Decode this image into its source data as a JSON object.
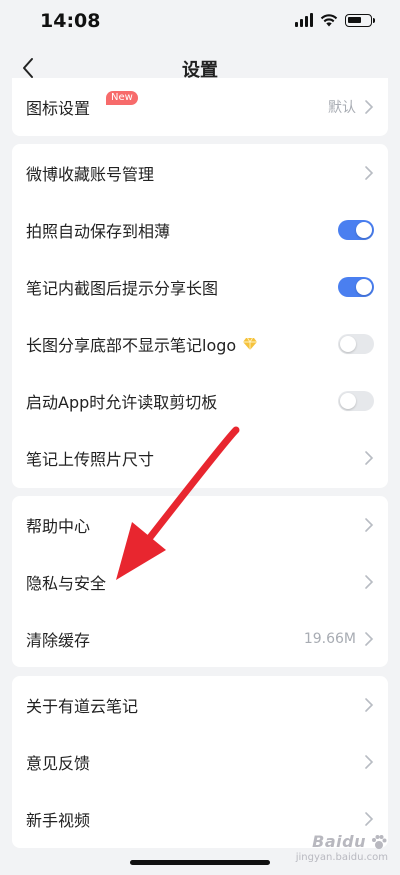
{
  "status_bar": {
    "time": "14:08",
    "icons": [
      "signal-icon",
      "wifi-icon",
      "battery-icon"
    ]
  },
  "nav": {
    "title": "设置",
    "back_icon": "chevron-left-icon"
  },
  "card_top": {
    "items": [
      {
        "label": "图标设置",
        "badge": "New",
        "value": "默认"
      }
    ]
  },
  "card_prefs": {
    "items": [
      {
        "label": "微博收藏账号管理"
      },
      {
        "label": "拍照自动保存到相薄",
        "toggle": true
      },
      {
        "label": "笔记内截图后提示分享长图",
        "toggle": true
      },
      {
        "label": "长图分享底部不显示笔记logo",
        "vip_icon": "diamond-icon",
        "toggle": false
      },
      {
        "label": "启动App时允许读取剪切板",
        "toggle": false
      },
      {
        "label": "笔记上传照片尺寸"
      }
    ]
  },
  "card_help": {
    "items": [
      {
        "label": "帮助中心"
      },
      {
        "label": "隐私与安全"
      },
      {
        "label": "清除缓存",
        "value": "19.66M"
      }
    ]
  },
  "card_about": {
    "items": [
      {
        "label": "关于有道云笔记"
      },
      {
        "label": "意见反馈"
      },
      {
        "label": "新手视频"
      }
    ]
  },
  "watermark": {
    "logo": "Baidu",
    "sub": "jingyan.baidu.com"
  },
  "colors": {
    "accent": "#4a7ff0",
    "badge": "#f76b6b",
    "arrow": "#e8262f",
    "background": "#f2f3f5"
  }
}
